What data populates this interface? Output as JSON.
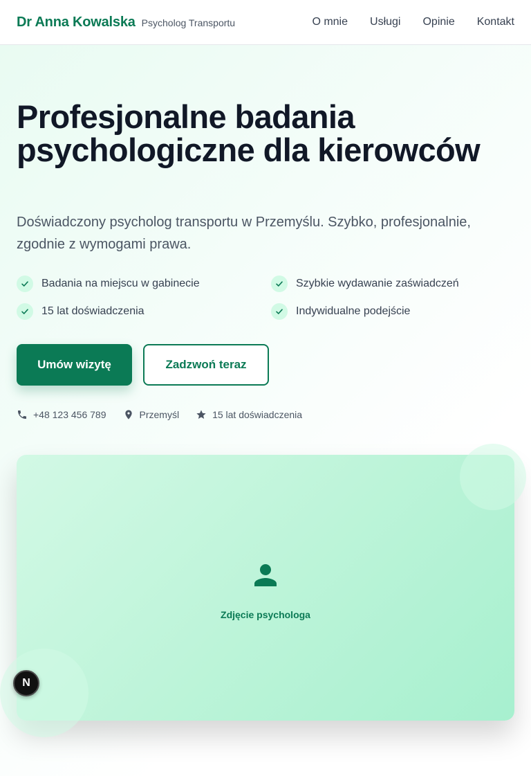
{
  "header": {
    "brand_name": "Dr Anna Kowalska",
    "brand_subtitle": "Psycholog Transportu",
    "nav": [
      {
        "label": "O mnie"
      },
      {
        "label": "Usługi"
      },
      {
        "label": "Opinie"
      },
      {
        "label": "Kontakt"
      }
    ]
  },
  "hero": {
    "title": "Profesjonalne badania psychologiczne dla kierowców",
    "lead": "Doświadczony psycholog transportu w Przemyślu. Szybko, profesjonalnie, zgodnie z wymogami prawa.",
    "features": [
      {
        "label": "Badania na miejscu w gabinecie",
        "icon": "check-icon"
      },
      {
        "label": "Szybkie wydawanie zaświadczeń",
        "icon": "check-icon"
      },
      {
        "label": "15 lat doświadczenia",
        "icon": "check-icon"
      },
      {
        "label": "Indywidualne podejście",
        "icon": "check-icon"
      }
    ],
    "primary_cta": "Umów wizytę",
    "secondary_cta": "Zadzwoń teraz",
    "contact": [
      {
        "icon": "phone-icon",
        "text": "+48 123 456 789"
      },
      {
        "icon": "map-pin-icon",
        "text": "Przemyśl"
      },
      {
        "icon": "star-icon",
        "text": "15 lat doświadczenia"
      }
    ],
    "photo_placeholder": {
      "icon": "person-icon",
      "label": "Zdjęcie psychologa"
    }
  },
  "floating_badge": {
    "label": "N"
  },
  "colors": {
    "accent": "#0b7a55",
    "accent_light": "#d1fae5",
    "text_dark": "#111827",
    "text_muted": "#4b5563"
  }
}
